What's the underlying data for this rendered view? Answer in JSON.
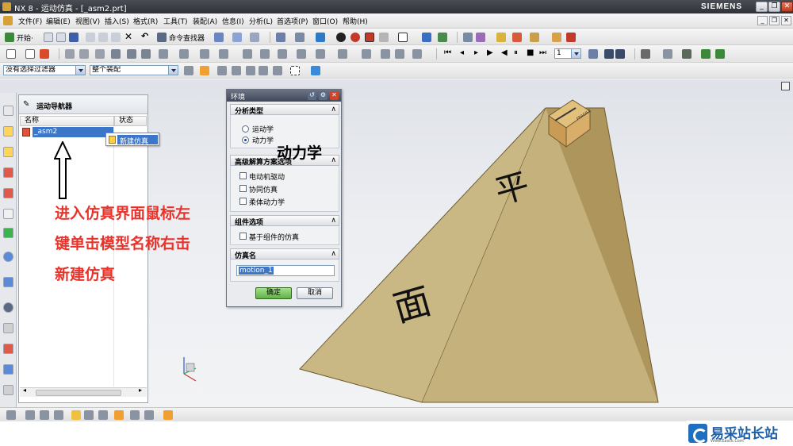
{
  "window": {
    "title": "NX 8 - 运动仿真 - [_asm2.prt]",
    "brand": "SIEMENS",
    "controls": [
      "_",
      "❐",
      "✕"
    ]
  },
  "menubar": {
    "items": [
      "文件(F)",
      "编辑(E)",
      "视图(V)",
      "插入(S)",
      "格式(R)",
      "工具(T)",
      "装配(A)",
      "信息(I)",
      "分析(L)",
      "首选项(P)",
      "窗口(O)",
      "帮助(H)"
    ]
  },
  "toolbar": {
    "start_label": "开始·",
    "command_finder": "命令查找器",
    "filter_value": "没有选择过滤器",
    "assembly_scope": "整个装配",
    "frame_value": "1"
  },
  "navigator": {
    "title": "运动导航器",
    "columns": [
      "名称",
      "状态"
    ],
    "rows": [
      {
        "name": "_asm2",
        "icon": "assembly-icon"
      }
    ]
  },
  "context_menu": {
    "items": [
      {
        "label": "新建仿真",
        "icon": "new-simulation-icon"
      }
    ]
  },
  "annotations": {
    "red_lines": [
      "进入仿真界面鼠标左",
      "键单击模型名称右击",
      "新建仿真"
    ],
    "dynamics_note": "动力学"
  },
  "dialog": {
    "title": "环境",
    "analysis_type": {
      "header": "分析类型",
      "options": [
        {
          "label": "运动学",
          "selected": false
        },
        {
          "label": "动力学",
          "selected": true
        }
      ]
    },
    "advanced_solver": {
      "header": "高级解算方案选项",
      "options": [
        {
          "label": "电动机驱动",
          "checked": false
        },
        {
          "label": "协同仿真",
          "checked": false
        },
        {
          "label": "柔体动力学",
          "checked": false
        }
      ]
    },
    "component_options": {
      "header": "组件选项",
      "options": [
        {
          "label": "基于组件的仿真",
          "checked": false
        }
      ]
    },
    "simulation_name": {
      "header": "仿真名",
      "value": "motion_1"
    },
    "ok_label": "确定",
    "cancel_label": "取消"
  },
  "scene": {
    "incline_text": [
      "平",
      "面"
    ],
    "box_label": "FRAGILE"
  },
  "watermark": {
    "name": "易采站长站",
    "url": "Www.Easck.Com"
  },
  "colors": {
    "accent_blue": "#3b76c9",
    "annotation_red": "#e8332a",
    "incline_face": "#cbb887",
    "incline_side": "#a78e55"
  }
}
